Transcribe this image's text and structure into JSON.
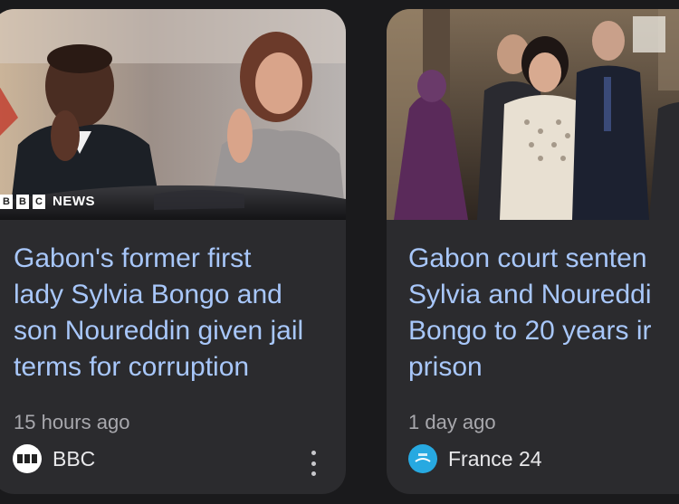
{
  "cards": [
    {
      "image_alt": "Ali Bongo and Sylvia Bongo waving",
      "image_overlay": {
        "letters": [
          "B",
          "B",
          "C"
        ],
        "word": "NEWS"
      },
      "headline_lines": [
        "Gabon's former first",
        "lady Sylvia Bongo and",
        "son Noureddin given jail",
        "terms for corruption"
      ],
      "time": "15 hours ago",
      "source": {
        "name": "BBC",
        "logo_icon": "bbc-logo-icon",
        "logo_color": "#ffffff"
      },
      "has_more_menu": true
    },
    {
      "image_alt": "Sylvia Bongo walking with officials",
      "headline_lines": [
        "Gabon court senten",
        "Sylvia and Noureddi",
        "Bongo to 20 years ir",
        "prison"
      ],
      "time": "1 day ago",
      "source": {
        "name": "France 24",
        "logo_icon": "france24-logo-icon",
        "logo_color": "#27a9e1"
      }
    }
  ],
  "colors": {
    "background": "#1a1a1c",
    "card": "#2b2b2e",
    "headline": "#a8c7fa",
    "meta": "#a8a8ad"
  }
}
